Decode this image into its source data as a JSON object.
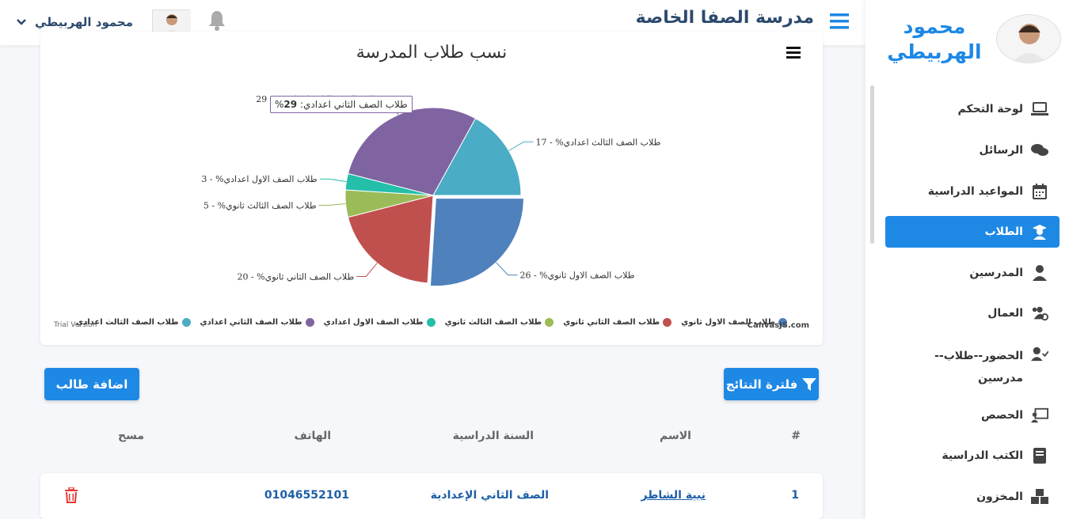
{
  "sidebar": {
    "user_name": "محمود الهربيطي",
    "items": [
      {
        "label": "لوحة التحكم",
        "icon": "laptop-icon"
      },
      {
        "label": "الرسائل",
        "icon": "comments-icon"
      },
      {
        "label": "المواعيد الدراسية",
        "icon": "calendar-icon"
      },
      {
        "label": "الطلاب",
        "icon": "graduate-icon",
        "active": true
      },
      {
        "label": "المدرسين",
        "icon": "teacher-icon"
      },
      {
        "label": "العمال",
        "icon": "users-cog-icon"
      },
      {
        "label": "الحضور--طلاب--مدرسين",
        "icon": "user-check-icon"
      },
      {
        "label": "الحصص",
        "icon": "chalkboard-icon"
      },
      {
        "label": "الكتب الدراسية",
        "icon": "book-icon"
      },
      {
        "label": "المخزون",
        "icon": "boxes-icon"
      }
    ]
  },
  "topbar": {
    "title": "مدرسة الصفا الخاصة",
    "user_name": "محمود الهربيطي"
  },
  "chart_data": {
    "type": "pie",
    "title": "نسب طلاب المدرسة",
    "slices": [
      {
        "name": "طلاب الصف الاول ثانوي",
        "label": "%طلاب الصف الاول ثانوي",
        "value": 26,
        "color": "#4f81bc"
      },
      {
        "name": "طلاب الصف الثاني ثانوي",
        "label": "%طلاب الصف الثاني ثانوي",
        "value": 20,
        "color": "#c0504e"
      },
      {
        "name": "طلاب الصف الثالث ثانوي",
        "label": "%طلاب الصف الثالث ثانوي",
        "value": 5,
        "color": "#9bbb58"
      },
      {
        "name": "طلاب الصف الاول اعدادي",
        "label": "%طلاب الصف الاول اعدادي",
        "value": 3,
        "color": "#23bfaa"
      },
      {
        "name": "طلاب الصف الثاني اعدادي",
        "label": "%طلاب الصف الثاني اعدادي",
        "value": 29,
        "color": "#8064a1"
      },
      {
        "name": "طلاب الصف الثالث اعدادي",
        "label": "%طلاب الصف الثالث اعدادي",
        "value": 17,
        "color": "#4aacc5"
      }
    ],
    "tooltip": {
      "label": "%طلاب الصف الثاني اعدادي:",
      "value": "29"
    },
    "credit": "CanvasJS.com",
    "trial": "Trial Version"
  },
  "buttons": {
    "add_student": "اضافة طالب",
    "filter_results": "فلترة النتائج"
  },
  "table": {
    "headers": {
      "index": "#",
      "name": "الاسم",
      "year": "السنة الدراسية",
      "phone": "الهاتف",
      "delete": "مسح"
    },
    "rows": [
      {
        "index": "1",
        "name": "نبية الشاطر",
        "year": "الصف الثاني الإعدادية",
        "phone": "01046552101"
      }
    ]
  }
}
